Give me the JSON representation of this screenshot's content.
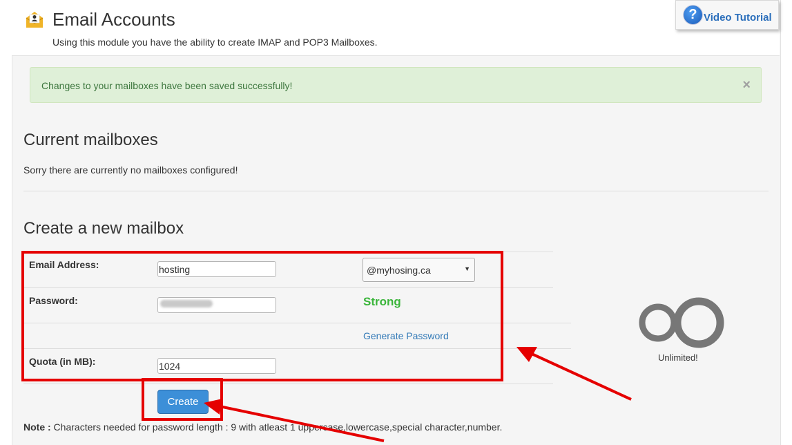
{
  "header": {
    "title": "Email Accounts",
    "subtitle": "Using this module you have the ability to create IMAP and POP3 Mailboxes.",
    "icon": "mailbox-user-icon",
    "video_tutorial_label": "Video Tutorial",
    "video_tutorial_icon": "question-circle-icon"
  },
  "alert": {
    "message": "Changes to your mailboxes have been saved successfully!",
    "close_symbol": "×",
    "color": "#dff0d8"
  },
  "current": {
    "title": "Current mailboxes",
    "empty_message": "Sorry there are currently no mailboxes configured!"
  },
  "create": {
    "title": "Create a new mailbox",
    "email_label": "Email Address:",
    "email_value": "hosting",
    "domain_selected": "@myhosing.ca",
    "password_label": "Password:",
    "password_strength": "Strong",
    "generate_password": "Generate Password",
    "quota_label": "Quota (in MB):",
    "quota_value": "1024",
    "create_button": "Create",
    "unlimited_label": "Unlimited!"
  },
  "note": {
    "label": "Note :",
    "text": " Characters needed for password length : 9 with atleast 1 uppercase,lowercase,special character,number."
  },
  "colors": {
    "annotation": "#e50000",
    "strong": "#3ab53a",
    "link": "#337ab7",
    "button": "#3c8fd8"
  }
}
